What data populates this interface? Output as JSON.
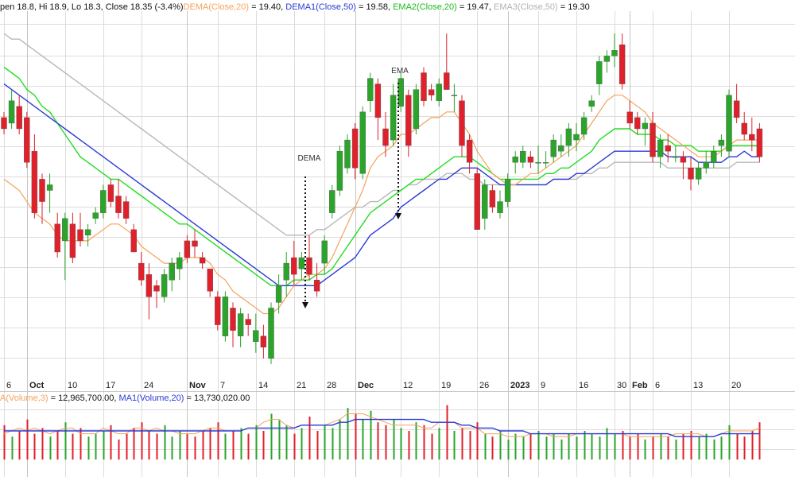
{
  "price_legend": [
    {
      "text": "pen 18.8, Hi 18.9, Lo 18.3, Close 18.35 (-3.4%)",
      "color": "#111111"
    },
    {
      "text": "DEMA(Close,20)",
      "color": "#f4a259"
    },
    {
      "text": " = 19.40, ",
      "color": "#111111"
    },
    {
      "text": "DEMA1(Close,50)",
      "color": "#2b3bd6"
    },
    {
      "text": " = 19.58, ",
      "color": "#111111"
    },
    {
      "text": "EMA2(Close,20)",
      "color": "#1db91d"
    },
    {
      "text": " = 19.47, ",
      "color": "#111111"
    },
    {
      "text": "EMA3(Close,50)",
      "color": "#b3b3b3"
    },
    {
      "text": " = 19.30",
      "color": "#111111"
    }
  ],
  "volume_legend": [
    {
      "text": "A(Volume,3)",
      "color": "#f4a259"
    },
    {
      "text": " = 12,965,700.00, ",
      "color": "#111111"
    },
    {
      "text": "MA1(Volume,20)",
      "color": "#2b3bd6"
    },
    {
      "text": " = 13,730,020.00",
      "color": "#111111"
    }
  ],
  "annotations": {
    "dema": "DEMA",
    "ema": "EMA"
  },
  "colors": {
    "up": "#2aa52a",
    "down": "#e0202a",
    "dema20": "#f4a259",
    "dema50": "#2b3bd6",
    "ema20": "#22dd22",
    "ema50": "#b8b8b8",
    "grid": "#dcdcdc"
  },
  "chart_data": {
    "type": "candlestick",
    "x_ticks": [
      {
        "label": "6",
        "bold": false,
        "i": 0
      },
      {
        "label": "Oct",
        "bold": true,
        "i": 3
      },
      {
        "label": "10",
        "bold": false,
        "i": 8
      },
      {
        "label": "17",
        "bold": false,
        "i": 13
      },
      {
        "label": "24",
        "bold": false,
        "i": 18
      },
      {
        "label": "Nov",
        "bold": true,
        "i": 24
      },
      {
        "label": "7",
        "bold": false,
        "i": 28
      },
      {
        "label": "14",
        "bold": false,
        "i": 33
      },
      {
        "label": "21",
        "bold": false,
        "i": 38
      },
      {
        "label": "28",
        "bold": false,
        "i": 42
      },
      {
        "label": "Dec",
        "bold": true,
        "i": 46
      },
      {
        "label": "12",
        "bold": false,
        "i": 52
      },
      {
        "label": "19",
        "bold": false,
        "i": 57
      },
      {
        "label": "26",
        "bold": false,
        "i": 62
      },
      {
        "label": "2023",
        "bold": true,
        "i": 66
      },
      {
        "label": "9",
        "bold": false,
        "i": 70
      },
      {
        "label": "16",
        "bold": false,
        "i": 75
      },
      {
        "label": "30",
        "bold": false,
        "i": 80
      },
      {
        "label": "Feb",
        "bold": true,
        "i": 82
      },
      {
        "label": "6",
        "bold": false,
        "i": 85
      },
      {
        "label": "13",
        "bold": false,
        "i": 90
      },
      {
        "label": "20",
        "bold": false,
        "i": 95
      }
    ],
    "candles": [
      [
        21.1,
        21.2,
        20.8,
        20.9
      ],
      [
        21.0,
        21.6,
        20.9,
        21.4
      ],
      [
        21.3,
        21.5,
        20.8,
        20.9
      ],
      [
        21.1,
        21.2,
        20.2,
        20.3
      ],
      [
        20.5,
        20.8,
        19.3,
        19.4
      ],
      [
        20.0,
        20.1,
        19.2,
        19.6
      ],
      [
        19.8,
        20.1,
        19.4,
        19.9
      ],
      [
        19.2,
        19.4,
        18.6,
        18.7
      ],
      [
        18.9,
        19.4,
        18.2,
        19.3
      ],
      [
        19.2,
        19.4,
        18.5,
        18.6
      ],
      [
        19.1,
        19.4,
        18.8,
        18.9
      ],
      [
        19.0,
        19.2,
        18.8,
        19.1
      ],
      [
        19.3,
        19.5,
        19.2,
        19.4
      ],
      [
        19.4,
        19.9,
        19.3,
        19.8
      ],
      [
        19.9,
        20.0,
        19.5,
        19.6
      ],
      [
        19.7,
        20.0,
        19.3,
        19.4
      ],
      [
        19.6,
        19.7,
        19.2,
        19.3
      ],
      [
        19.1,
        19.2,
        18.7,
        18.7
      ],
      [
        18.5,
        18.7,
        18.1,
        18.2
      ],
      [
        18.3,
        18.5,
        17.5,
        17.9
      ],
      [
        18.1,
        18.2,
        17.7,
        18.0
      ],
      [
        17.9,
        18.4,
        17.8,
        18.3
      ],
      [
        18.2,
        18.6,
        18.0,
        18.5
      ],
      [
        18.4,
        18.7,
        18.2,
        18.6
      ],
      [
        18.9,
        19.0,
        18.5,
        18.6
      ],
      [
        18.9,
        19.1,
        18.6,
        18.8
      ],
      [
        18.6,
        18.7,
        18.4,
        18.5
      ],
      [
        18.4,
        18.4,
        17.9,
        18.0
      ],
      [
        17.9,
        18.0,
        17.3,
        17.4
      ],
      [
        17.2,
        18.0,
        17.1,
        17.9
      ],
      [
        17.7,
        17.8,
        17.0,
        17.3
      ],
      [
        17.2,
        17.7,
        17.0,
        17.6
      ],
      [
        17.5,
        17.6,
        17.2,
        17.4
      ],
      [
        17.1,
        17.6,
        16.9,
        17.3
      ],
      [
        17.2,
        17.4,
        16.8,
        17.0
      ],
      [
        16.8,
        17.8,
        16.7,
        17.7
      ],
      [
        17.8,
        18.3,
        17.6,
        18.1
      ],
      [
        18.2,
        18.7,
        17.9,
        18.5
      ],
      [
        18.6,
        18.9,
        18.1,
        18.3
      ],
      [
        18.4,
        18.7,
        18.2,
        18.6
      ],
      [
        18.6,
        19.0,
        18.2,
        18.3
      ],
      [
        18.2,
        18.5,
        17.9,
        18.0
      ],
      [
        18.5,
        19.0,
        18.3,
        18.9
      ],
      [
        19.4,
        19.9,
        19.3,
        19.8
      ],
      [
        19.8,
        20.6,
        19.7,
        20.5
      ],
      [
        20.2,
        20.8,
        20.1,
        20.7
      ],
      [
        20.9,
        21.0,
        20.0,
        20.2
      ],
      [
        20.1,
        21.3,
        20.0,
        21.2
      ],
      [
        21.4,
        21.9,
        21.2,
        21.8
      ],
      [
        21.7,
        21.8,
        20.7,
        21.1
      ],
      [
        20.9,
        21.2,
        20.4,
        20.6
      ],
      [
        20.7,
        21.7,
        20.6,
        21.5
      ],
      [
        21.3,
        21.9,
        21.2,
        21.8
      ],
      [
        21.5,
        21.6,
        20.4,
        20.6
      ],
      [
        20.9,
        21.7,
        20.8,
        21.6
      ],
      [
        21.9,
        22.0,
        21.3,
        21.4
      ],
      [
        21.6,
        21.7,
        21.4,
        21.5
      ],
      [
        21.4,
        21.8,
        21.3,
        21.7
      ],
      [
        21.9,
        22.6,
        21.6,
        21.6
      ],
      [
        21.5,
        21.7,
        21.2,
        21.5
      ],
      [
        21.4,
        21.5,
        20.4,
        20.6
      ],
      [
        20.7,
        20.8,
        20.1,
        20.3
      ],
      [
        20.1,
        20.2,
        19.1,
        19.1
      ],
      [
        19.3,
        20.0,
        19.1,
        19.9
      ],
      [
        19.8,
        19.9,
        19.4,
        19.5
      ],
      [
        19.4,
        19.8,
        19.3,
        19.6
      ],
      [
        19.6,
        20.1,
        19.5,
        20.0
      ],
      [
        20.3,
        20.5,
        20.1,
        20.4
      ],
      [
        20.3,
        20.6,
        20.2,
        20.5
      ],
      [
        20.4,
        20.5,
        20.2,
        20.3
      ],
      [
        20.3,
        20.6,
        20.1,
        20.3
      ],
      [
        20.3,
        20.5,
        20.2,
        20.3
      ],
      [
        20.4,
        20.8,
        20.3,
        20.7
      ],
      [
        20.5,
        20.8,
        20.4,
        20.6
      ],
      [
        20.6,
        21.0,
        20.4,
        20.9
      ],
      [
        20.7,
        21.0,
        20.5,
        20.8
      ],
      [
        20.8,
        21.2,
        20.7,
        21.1
      ],
      [
        21.3,
        21.5,
        21.2,
        21.4
      ],
      [
        21.7,
        22.2,
        21.5,
        22.1
      ],
      [
        22.1,
        22.3,
        21.9,
        22.2
      ],
      [
        22.2,
        22.6,
        22.0,
        22.3
      ],
      [
        22.4,
        22.6,
        21.6,
        21.7
      ],
      [
        21.2,
        21.4,
        20.9,
        21.0
      ],
      [
        21.1,
        21.2,
        20.8,
        20.9
      ],
      [
        20.9,
        21.1,
        20.6,
        21.0
      ],
      [
        21.0,
        21.2,
        20.3,
        20.4
      ],
      [
        20.4,
        20.8,
        20.2,
        20.7
      ],
      [
        20.6,
        20.8,
        20.3,
        20.5
      ],
      [
        20.4,
        20.6,
        20.3,
        20.4
      ],
      [
        20.4,
        20.5,
        20.0,
        20.3
      ],
      [
        20.2,
        20.4,
        19.8,
        20.0
      ],
      [
        20.0,
        20.3,
        19.9,
        20.2
      ],
      [
        20.2,
        20.5,
        20.1,
        20.3
      ],
      [
        20.3,
        20.6,
        20.2,
        20.5
      ],
      [
        20.6,
        20.8,
        20.4,
        20.7
      ],
      [
        20.5,
        21.6,
        20.4,
        21.5
      ],
      [
        21.4,
        21.7,
        21.0,
        21.1
      ],
      [
        21.0,
        21.2,
        20.7,
        20.8
      ],
      [
        20.8,
        21.1,
        20.5,
        20.7
      ],
      [
        20.9,
        21.0,
        20.3,
        20.4
      ]
    ],
    "volume": [
      12,
      8,
      10,
      14,
      9,
      11,
      8,
      10,
      13,
      9,
      11,
      8,
      9,
      10,
      12,
      7,
      9,
      11,
      13,
      10,
      9,
      12,
      8,
      10,
      9,
      8,
      10,
      11,
      13,
      9,
      10,
      11,
      9,
      12,
      10,
      16,
      14,
      12,
      9,
      11,
      15,
      10,
      12,
      11,
      14,
      18,
      16,
      14,
      17,
      13,
      12,
      14,
      11,
      10,
      13,
      12,
      9,
      11,
      19,
      10,
      11,
      10,
      13,
      9,
      8,
      10,
      7,
      9,
      8,
      9,
      10,
      8,
      9,
      7,
      9,
      8,
      10,
      9,
      8,
      11,
      9,
      10,
      8,
      9,
      7,
      8,
      9,
      8,
      7,
      9,
      10,
      8,
      9,
      7,
      8,
      12,
      9,
      8,
      10,
      13
    ],
    "dema20": [
      20.0,
      19.9,
      19.8,
      19.6,
      19.4,
      19.3,
      19.2,
      19.0,
      18.9,
      18.9,
      18.9,
      18.9,
      19.0,
      19.1,
      19.2,
      19.2,
      19.1,
      19.0,
      18.8,
      18.7,
      18.6,
      18.5,
      18.5,
      18.5,
      18.6,
      18.6,
      18.6,
      18.5,
      18.3,
      18.2,
      18.0,
      17.9,
      17.8,
      17.7,
      17.6,
      17.6,
      17.7,
      17.9,
      18.1,
      18.2,
      18.3,
      18.3,
      18.4,
      18.6,
      18.9,
      19.2,
      19.5,
      19.8,
      20.2,
      20.4,
      20.5,
      20.6,
      20.8,
      20.8,
      20.9,
      21.0,
      21.1,
      21.1,
      21.2,
      21.2,
      21.0,
      20.8,
      20.5,
      20.3,
      20.1,
      20.0,
      19.9,
      19.9,
      20.0,
      20.1,
      20.1,
      20.2,
      20.3,
      20.4,
      20.5,
      20.6,
      20.8,
      21.0,
      21.2,
      21.4,
      21.5,
      21.5,
      21.4,
      21.3,
      21.2,
      21.0,
      20.9,
      20.8,
      20.7,
      20.6,
      20.5,
      20.4,
      20.4,
      20.4,
      20.5,
      20.6,
      20.7,
      20.7,
      20.7,
      20.7
    ],
    "dema50": [
      21.7,
      21.6,
      21.5,
      21.4,
      21.3,
      21.2,
      21.1,
      21.0,
      20.9,
      20.8,
      20.7,
      20.6,
      20.5,
      20.4,
      20.3,
      20.2,
      20.1,
      20.0,
      19.9,
      19.8,
      19.7,
      19.6,
      19.5,
      19.4,
      19.3,
      19.2,
      19.1,
      19.0,
      18.9,
      18.8,
      18.7,
      18.6,
      18.5,
      18.4,
      18.3,
      18.2,
      18.1,
      18.1,
      18.1,
      18.1,
      18.1,
      18.1,
      18.2,
      18.3,
      18.4,
      18.5,
      18.6,
      18.8,
      19.0,
      19.1,
      19.2,
      19.3,
      19.5,
      19.6,
      19.7,
      19.8,
      19.9,
      20.0,
      20.0,
      20.1,
      20.2,
      20.2,
      20.2,
      20.1,
      20.0,
      19.9,
      19.9,
      19.9,
      19.9,
      19.9,
      19.9,
      19.9,
      20.0,
      20.0,
      20.0,
      20.1,
      20.1,
      20.2,
      20.3,
      20.4,
      20.5,
      20.5,
      20.5,
      20.5,
      20.5,
      20.5,
      20.5,
      20.4,
      20.4,
      20.4,
      20.4,
      20.3,
      20.3,
      20.3,
      20.3,
      20.4,
      20.4,
      20.5,
      20.4,
      20.4
    ],
    "ema20": [
      22.0,
      21.9,
      21.8,
      21.6,
      21.5,
      21.3,
      21.2,
      21.0,
      20.8,
      20.6,
      20.4,
      20.3,
      20.2,
      20.1,
      20.0,
      20.0,
      19.9,
      19.8,
      19.7,
      19.6,
      19.5,
      19.4,
      19.3,
      19.2,
      19.2,
      19.1,
      19.0,
      18.9,
      18.8,
      18.7,
      18.6,
      18.5,
      18.4,
      18.3,
      18.2,
      18.1,
      18.1,
      18.1,
      18.2,
      18.2,
      18.2,
      18.3,
      18.3,
      18.4,
      18.6,
      18.8,
      19.0,
      19.2,
      19.4,
      19.5,
      19.6,
      19.7,
      19.8,
      19.9,
      20.0,
      20.0,
      20.1,
      20.2,
      20.3,
      20.4,
      20.4,
      20.4,
      20.3,
      20.2,
      20.1,
      20.0,
      20.0,
      20.0,
      20.0,
      20.0,
      20.0,
      20.1,
      20.1,
      20.2,
      20.2,
      20.3,
      20.4,
      20.5,
      20.7,
      20.8,
      20.9,
      20.9,
      20.9,
      20.8,
      20.8,
      20.8,
      20.7,
      20.7,
      20.6,
      20.6,
      20.6,
      20.5,
      20.5,
      20.5,
      20.5,
      20.6,
      20.6,
      20.6,
      20.6,
      20.6
    ],
    "ema50": [
      22.6,
      22.5,
      22.5,
      22.4,
      22.3,
      22.2,
      22.1,
      22.0,
      21.9,
      21.8,
      21.7,
      21.6,
      21.5,
      21.4,
      21.3,
      21.2,
      21.1,
      21.0,
      20.9,
      20.8,
      20.7,
      20.6,
      20.5,
      20.4,
      20.3,
      20.2,
      20.1,
      20.0,
      19.9,
      19.8,
      19.7,
      19.6,
      19.5,
      19.4,
      19.3,
      19.2,
      19.1,
      19.0,
      19.0,
      19.0,
      19.0,
      19.1,
      19.1,
      19.2,
      19.3,
      19.4,
      19.5,
      19.5,
      19.6,
      19.6,
      19.7,
      19.8,
      19.8,
      19.9,
      19.9,
      20.0,
      20.0,
      20.0,
      20.1,
      20.1,
      20.1,
      20.0,
      20.0,
      19.9,
      19.9,
      19.9,
      19.9,
      19.9,
      19.9,
      19.9,
      19.9,
      19.9,
      20.0,
      20.0,
      20.0,
      20.0,
      20.1,
      20.1,
      20.2,
      20.2,
      20.3,
      20.3,
      20.3,
      20.3,
      20.3,
      20.3,
      20.3,
      20.2,
      20.2,
      20.2,
      20.2,
      20.2,
      20.2,
      20.2,
      20.2,
      20.2,
      20.3,
      20.3,
      20.3,
      20.3
    ],
    "vol_ma3": [
      9,
      10,
      11,
      10,
      11,
      10,
      9,
      10,
      11,
      11,
      9,
      9,
      9,
      11,
      10,
      9,
      9,
      11,
      11,
      10,
      11,
      10,
      10,
      9,
      9,
      9,
      10,
      11,
      11,
      10,
      10,
      10,
      11,
      11,
      13,
      14,
      14,
      12,
      11,
      12,
      12,
      12,
      12,
      13,
      14,
      16,
      16,
      16,
      15,
      14,
      13,
      12,
      12,
      12,
      12,
      11,
      11,
      13,
      13,
      13,
      11,
      11,
      11,
      9,
      9,
      9,
      8,
      8,
      8,
      9,
      9,
      9,
      8,
      8,
      8,
      9,
      9,
      9,
      9,
      9,
      9,
      9,
      8,
      8,
      8,
      8,
      8,
      8,
      9,
      9,
      9,
      9,
      8,
      8,
      9,
      10,
      10,
      10,
      10,
      11
    ],
    "vol_ma20": [
      10,
      10,
      10,
      10,
      10,
      10,
      10,
      10,
      10,
      10,
      10,
      10,
      10,
      10,
      10,
      10,
      10,
      10,
      10,
      10,
      10,
      10,
      10,
      10,
      10,
      10,
      10,
      10,
      10,
      10,
      10,
      10,
      11,
      11,
      11,
      11,
      11,
      11,
      11,
      12,
      12,
      12,
      12,
      12,
      13,
      13,
      14,
      14,
      14,
      14,
      14,
      14,
      14,
      14,
      14,
      14,
      13,
      13,
      13,
      13,
      12,
      12,
      11,
      11,
      11,
      10,
      10,
      10,
      10,
      9,
      9,
      9,
      9,
      9,
      9,
      9,
      9,
      9,
      9,
      9,
      9,
      9,
      9,
      9,
      9,
      9,
      9,
      9,
      8,
      8,
      8,
      8,
      8,
      8,
      9,
      9,
      9,
      9,
      9,
      9
    ]
  }
}
